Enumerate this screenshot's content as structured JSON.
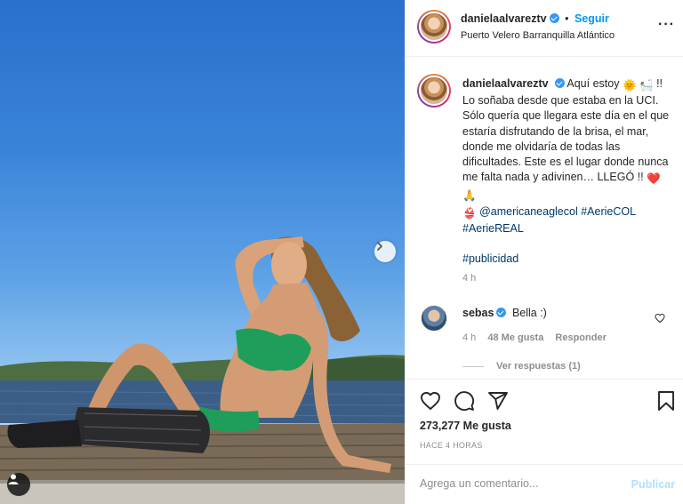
{
  "post": {
    "username": "danielaalvareztv",
    "follow_label": "Seguir",
    "dot": "•",
    "location": "Puerto Velero Barranquilla Atlántico",
    "more_label": "···"
  },
  "caption": {
    "username": "danielaalvareztv",
    "text_1": "Aquí estoy",
    "emoji_sun": "🌞",
    "emoji_bath": "🛀",
    "text_2": "!! Lo soñaba desde que estaba en la UCI. Sólo quería que llegara este día en el que estaría disfrutando de la brisa, el mar, donde me olvidaría de todas las dificultades. Este es el lugar donde nunca me falta nada y adivinen… LLEGÓ !!",
    "emoji_heart": "❤️",
    "emoji_pray": "🙏",
    "emoji_bikini": "👙",
    "mention": "@americaneaglecol",
    "hashtag_1": "#AerieCOL",
    "hashtag_2": "#AerieREAL",
    "hashtag_3": "#publicidad",
    "time": "4 h"
  },
  "comment": {
    "username": "sebas",
    "text": "Bella :)",
    "time": "4 h",
    "likes": "48 Me gusta",
    "reply_label": "Responder",
    "view_replies": "Ver respuestas (1)"
  },
  "actions": {
    "likes_count": "273,277 Me gusta",
    "post_time": "HACE 4 HORAS"
  },
  "comment_box": {
    "placeholder": "Agrega un comentario...",
    "publish_label": "Publicar"
  },
  "colors": {
    "link": "#0095f6",
    "verified": "#3897f0",
    "heart": "#ed4956"
  },
  "icons": [
    "verified-icon",
    "chevron-right-icon",
    "user-tag-icon",
    "heart-icon",
    "comment-icon",
    "share-icon",
    "bookmark-icon"
  ]
}
